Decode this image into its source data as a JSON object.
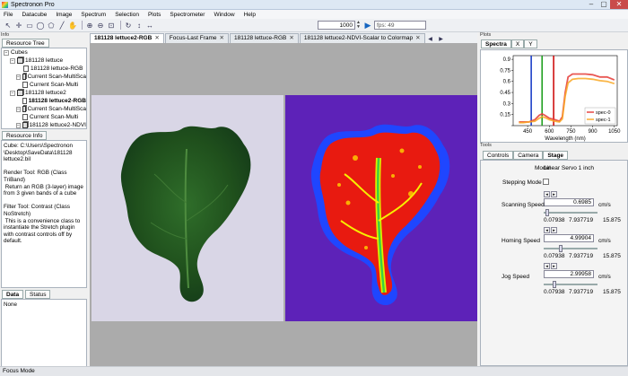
{
  "window": {
    "title": "Spectronon Pro"
  },
  "menu": [
    "File",
    "Datacube",
    "Image",
    "Spectrum",
    "Selection",
    "Plots",
    "Spectrometer",
    "Window",
    "Help"
  ],
  "toolbar": {
    "frame_value": "1000",
    "fps": "fps: 49"
  },
  "left": {
    "dock_label": "Info",
    "resource_tree_tab": "Resource Tree",
    "tree": [
      {
        "label": "Cubes",
        "level": 0,
        "kind": "folder",
        "bold": false
      },
      {
        "label": "181128 lettuce",
        "level": 1,
        "kind": "cube",
        "bold": false
      },
      {
        "label": "181128 lettuce-RGB",
        "level": 2,
        "kind": "doc",
        "bold": false
      },
      {
        "label": "Current Scan-MultiSca",
        "level": 2,
        "kind": "cube",
        "bold": false
      },
      {
        "label": "Current Scan-Multi",
        "level": 3,
        "kind": "doc",
        "bold": false
      },
      {
        "label": "181128 lettuce2",
        "level": 1,
        "kind": "cube",
        "bold": false
      },
      {
        "label": "181128 lettuce2-RGB",
        "level": 2,
        "kind": "doc",
        "bold": true
      },
      {
        "label": "Current Scan-MultiSca",
        "level": 2,
        "kind": "cube",
        "bold": false
      },
      {
        "label": "Current Scan-Multi",
        "level": 3,
        "kind": "doc",
        "bold": false
      },
      {
        "label": "181128 lettuce2-NDVI",
        "level": 2,
        "kind": "cube",
        "bold": false
      }
    ],
    "resource_info_tab": "Resource Info",
    "info_lines": [
      "Cube: C:\\Users\\Spectronon",
      "\\Desktop\\SaveData\\181128",
      "lettuce2.bil",
      "",
      "Render Tool: RGB (Class",
      "TriBand)",
      " Return an RGB (3-layer) image",
      "from 3 given bands of a cube",
      "",
      "Filter Tool: Contrast (Class",
      "NoStretch)",
      " This is a convenience class to",
      "instantiate the Stretch plugin",
      "with contrast controls off by",
      "default."
    ],
    "data_tab": "Data",
    "status_tab": "Status",
    "data_value": "None"
  },
  "center": {
    "tabs": [
      {
        "label": "181128 lettuce2-RGB",
        "active": true
      },
      {
        "label": "Focus-Last Frame",
        "active": false
      },
      {
        "label": "181128 lettuce-RGB",
        "active": false
      },
      {
        "label": "181128 lettuce2-NDVI-Scalar to Colormap",
        "active": false
      }
    ]
  },
  "plots": {
    "dock_label": "Plots",
    "tabs": [
      "Spectra",
      "X",
      "Y"
    ],
    "chart_data": {
      "type": "line",
      "xlabel": "Wavelength (nm)",
      "xlim": [
        350,
        1070
      ],
      "ylim": [
        0.0,
        0.95
      ],
      "xticks": [
        300,
        450,
        600,
        750,
        900,
        1050
      ],
      "yticks": [
        0.0,
        0.15,
        0.3,
        0.45,
        0.6,
        0.75,
        0.9
      ],
      "ytick_labels": [
        "",
        "0.15",
        "0.3",
        "0.45",
        "0.6",
        "0.75",
        "0.9"
      ],
      "legend_position": "lower-right",
      "series": [
        {
          "name": "spec-0",
          "color": "#e53935",
          "x": [
            390,
            420,
            460,
            500,
            530,
            550,
            570,
            600,
            640,
            670,
            690,
            710,
            730,
            760,
            800,
            850,
            900,
            950,
            1000,
            1050
          ],
          "y": [
            0.05,
            0.05,
            0.05,
            0.08,
            0.14,
            0.16,
            0.14,
            0.1,
            0.08,
            0.06,
            0.12,
            0.45,
            0.66,
            0.7,
            0.7,
            0.7,
            0.69,
            0.66,
            0.66,
            0.62
          ]
        },
        {
          "name": "spec-1",
          "color": "#f9a825",
          "x": [
            390,
            420,
            460,
            500,
            530,
            550,
            570,
            600,
            640,
            670,
            690,
            710,
            730,
            760,
            800,
            850,
            900,
            950,
            1000,
            1050
          ],
          "y": [
            0.04,
            0.04,
            0.05,
            0.06,
            0.1,
            0.12,
            0.11,
            0.08,
            0.06,
            0.05,
            0.09,
            0.4,
            0.58,
            0.63,
            0.64,
            0.64,
            0.63,
            0.61,
            0.6,
            0.57
          ]
        }
      ],
      "band_markers": [
        {
          "x": 475,
          "color": "#1e40c8"
        },
        {
          "x": 550,
          "color": "#20a020"
        },
        {
          "x": 630,
          "color": "#d01010"
        }
      ]
    }
  },
  "tools": {
    "dock_label": "Tools",
    "tabs": [
      "Controls",
      "Camera",
      "Stage"
    ],
    "active_tab": "Stage",
    "model_label": "Model",
    "model_value": "Linear Servo 1 inch",
    "stepping_label": "Stepping Mode",
    "speeds": [
      {
        "label": "Scanning Speed",
        "value": "0.6985",
        "unit": "cm/s",
        "min": "0.07938",
        "mid": "7.937719",
        "max": "15.875",
        "fraction": 0.04
      },
      {
        "label": "Homing Speed",
        "value": "4.99904",
        "unit": "cm/s",
        "min": "0.07938",
        "mid": "7.937719",
        "max": "15.875",
        "fraction": 0.31
      },
      {
        "label": "Jog Speed",
        "value": "2.99958",
        "unit": "cm/s",
        "min": "0.07938",
        "mid": "7.937719",
        "max": "15.875",
        "fraction": 0.18
      }
    ]
  },
  "status": {
    "text": "Focus Mode"
  }
}
